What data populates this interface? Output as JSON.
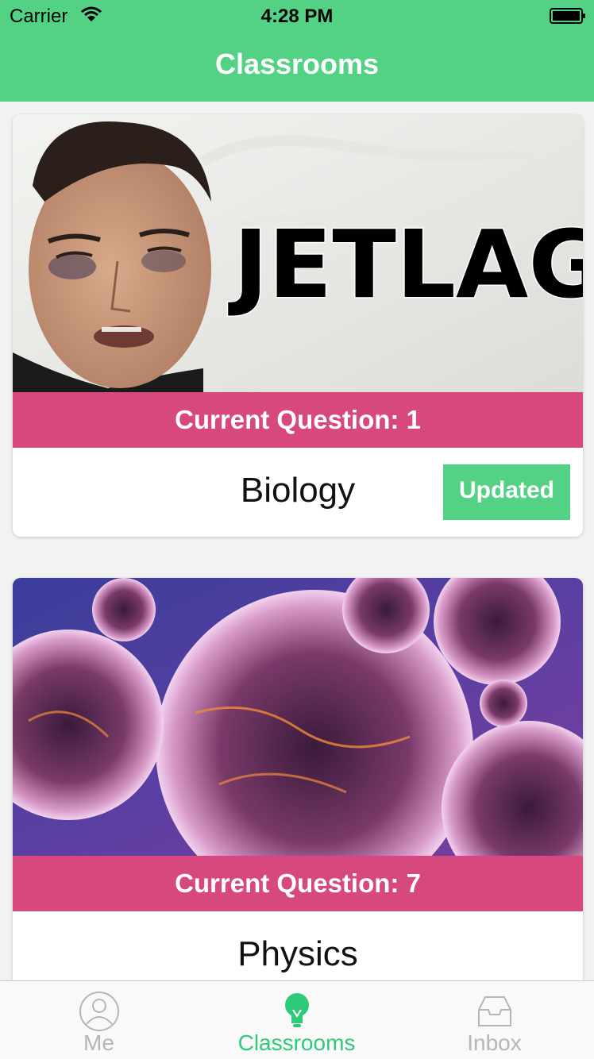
{
  "status_bar": {
    "carrier": "Carrier",
    "time": "4:28 PM"
  },
  "nav": {
    "title": "Classrooms"
  },
  "classrooms": [
    {
      "image_text": "JETLAG",
      "question_label": "Current Question: 1",
      "name": "Biology",
      "badge": "Updated"
    },
    {
      "question_label": "Current Question: 7",
      "name": "Physics"
    }
  ],
  "tabs": [
    {
      "label": "Me",
      "icon": "person-icon",
      "active": false
    },
    {
      "label": "Classrooms",
      "icon": "lightbulb-icon",
      "active": true
    },
    {
      "label": "Inbox",
      "icon": "inbox-icon",
      "active": false
    }
  ],
  "colors": {
    "accent": "#53d184",
    "banner": "#d6487e",
    "tab_active": "#2fc97a",
    "tab_inactive": "#b6b6b6"
  }
}
